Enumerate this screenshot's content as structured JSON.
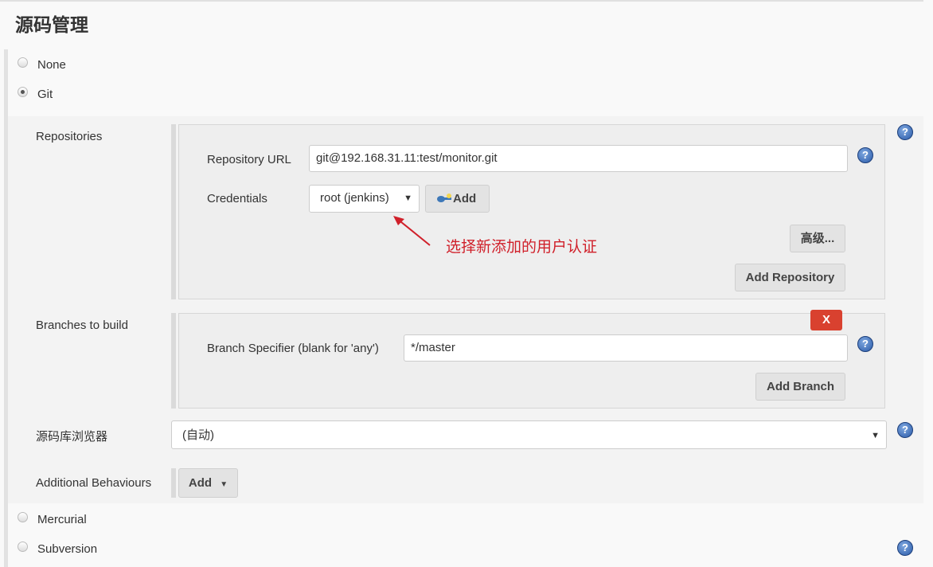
{
  "section_title": "源码管理",
  "scm_options": {
    "none": "None",
    "git": "Git",
    "mercurial": "Mercurial",
    "subversion": "Subversion"
  },
  "selected_scm": "Git",
  "repositories": {
    "label": "Repositories",
    "url_label": "Repository URL",
    "url_value": "git@192.168.31.11:test/monitor.git",
    "credentials_label": "Credentials",
    "credentials_value": "root (jenkins)",
    "add_credentials_label": "Add",
    "advanced_label": "高级...",
    "add_repository_label": "Add Repository"
  },
  "annotation": "选择新添加的用户认证",
  "branches": {
    "label": "Branches to build",
    "delete_label": "X",
    "specifier_label": "Branch Specifier (blank for 'any')",
    "specifier_value": "*/master",
    "add_branch_label": "Add Branch"
  },
  "browser": {
    "label": "源码库浏览器",
    "value": "(自动)"
  },
  "behaviours": {
    "label": "Additional Behaviours",
    "add_label": "Add"
  },
  "help_glyph": "?",
  "colors": {
    "delete_button": "#d9412f",
    "annotation": "#d0202a",
    "help_icon": "#2a5aa8"
  }
}
